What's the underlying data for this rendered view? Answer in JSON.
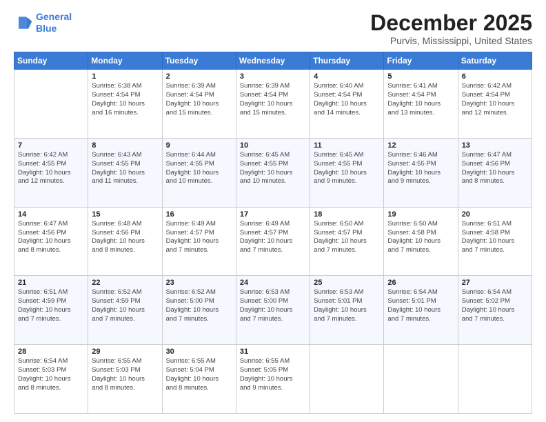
{
  "logo": {
    "line1": "General",
    "line2": "Blue"
  },
  "title": "December 2025",
  "subtitle": "Purvis, Mississippi, United States",
  "days_of_week": [
    "Sunday",
    "Monday",
    "Tuesday",
    "Wednesday",
    "Thursday",
    "Friday",
    "Saturday"
  ],
  "weeks": [
    [
      {
        "day": "",
        "detail": ""
      },
      {
        "day": "1",
        "detail": "Sunrise: 6:38 AM\nSunset: 4:54 PM\nDaylight: 10 hours\nand 16 minutes."
      },
      {
        "day": "2",
        "detail": "Sunrise: 6:39 AM\nSunset: 4:54 PM\nDaylight: 10 hours\nand 15 minutes."
      },
      {
        "day": "3",
        "detail": "Sunrise: 6:39 AM\nSunset: 4:54 PM\nDaylight: 10 hours\nand 15 minutes."
      },
      {
        "day": "4",
        "detail": "Sunrise: 6:40 AM\nSunset: 4:54 PM\nDaylight: 10 hours\nand 14 minutes."
      },
      {
        "day": "5",
        "detail": "Sunrise: 6:41 AM\nSunset: 4:54 PM\nDaylight: 10 hours\nand 13 minutes."
      },
      {
        "day": "6",
        "detail": "Sunrise: 6:42 AM\nSunset: 4:54 PM\nDaylight: 10 hours\nand 12 minutes."
      }
    ],
    [
      {
        "day": "7",
        "detail": "Sunrise: 6:42 AM\nSunset: 4:55 PM\nDaylight: 10 hours\nand 12 minutes."
      },
      {
        "day": "8",
        "detail": "Sunrise: 6:43 AM\nSunset: 4:55 PM\nDaylight: 10 hours\nand 11 minutes."
      },
      {
        "day": "9",
        "detail": "Sunrise: 6:44 AM\nSunset: 4:55 PM\nDaylight: 10 hours\nand 10 minutes."
      },
      {
        "day": "10",
        "detail": "Sunrise: 6:45 AM\nSunset: 4:55 PM\nDaylight: 10 hours\nand 10 minutes."
      },
      {
        "day": "11",
        "detail": "Sunrise: 6:45 AM\nSunset: 4:55 PM\nDaylight: 10 hours\nand 9 minutes."
      },
      {
        "day": "12",
        "detail": "Sunrise: 6:46 AM\nSunset: 4:55 PM\nDaylight: 10 hours\nand 9 minutes."
      },
      {
        "day": "13",
        "detail": "Sunrise: 6:47 AM\nSunset: 4:56 PM\nDaylight: 10 hours\nand 8 minutes."
      }
    ],
    [
      {
        "day": "14",
        "detail": "Sunrise: 6:47 AM\nSunset: 4:56 PM\nDaylight: 10 hours\nand 8 minutes."
      },
      {
        "day": "15",
        "detail": "Sunrise: 6:48 AM\nSunset: 4:56 PM\nDaylight: 10 hours\nand 8 minutes."
      },
      {
        "day": "16",
        "detail": "Sunrise: 6:49 AM\nSunset: 4:57 PM\nDaylight: 10 hours\nand 7 minutes."
      },
      {
        "day": "17",
        "detail": "Sunrise: 6:49 AM\nSunset: 4:57 PM\nDaylight: 10 hours\nand 7 minutes."
      },
      {
        "day": "18",
        "detail": "Sunrise: 6:50 AM\nSunset: 4:57 PM\nDaylight: 10 hours\nand 7 minutes."
      },
      {
        "day": "19",
        "detail": "Sunrise: 6:50 AM\nSunset: 4:58 PM\nDaylight: 10 hours\nand 7 minutes."
      },
      {
        "day": "20",
        "detail": "Sunrise: 6:51 AM\nSunset: 4:58 PM\nDaylight: 10 hours\nand 7 minutes."
      }
    ],
    [
      {
        "day": "21",
        "detail": "Sunrise: 6:51 AM\nSunset: 4:59 PM\nDaylight: 10 hours\nand 7 minutes."
      },
      {
        "day": "22",
        "detail": "Sunrise: 6:52 AM\nSunset: 4:59 PM\nDaylight: 10 hours\nand 7 minutes."
      },
      {
        "day": "23",
        "detail": "Sunrise: 6:52 AM\nSunset: 5:00 PM\nDaylight: 10 hours\nand 7 minutes."
      },
      {
        "day": "24",
        "detail": "Sunrise: 6:53 AM\nSunset: 5:00 PM\nDaylight: 10 hours\nand 7 minutes."
      },
      {
        "day": "25",
        "detail": "Sunrise: 6:53 AM\nSunset: 5:01 PM\nDaylight: 10 hours\nand 7 minutes."
      },
      {
        "day": "26",
        "detail": "Sunrise: 6:54 AM\nSunset: 5:01 PM\nDaylight: 10 hours\nand 7 minutes."
      },
      {
        "day": "27",
        "detail": "Sunrise: 6:54 AM\nSunset: 5:02 PM\nDaylight: 10 hours\nand 7 minutes."
      }
    ],
    [
      {
        "day": "28",
        "detail": "Sunrise: 6:54 AM\nSunset: 5:03 PM\nDaylight: 10 hours\nand 8 minutes."
      },
      {
        "day": "29",
        "detail": "Sunrise: 6:55 AM\nSunset: 5:03 PM\nDaylight: 10 hours\nand 8 minutes."
      },
      {
        "day": "30",
        "detail": "Sunrise: 6:55 AM\nSunset: 5:04 PM\nDaylight: 10 hours\nand 8 minutes."
      },
      {
        "day": "31",
        "detail": "Sunrise: 6:55 AM\nSunset: 5:05 PM\nDaylight: 10 hours\nand 9 minutes."
      },
      {
        "day": "",
        "detail": ""
      },
      {
        "day": "",
        "detail": ""
      },
      {
        "day": "",
        "detail": ""
      }
    ]
  ]
}
